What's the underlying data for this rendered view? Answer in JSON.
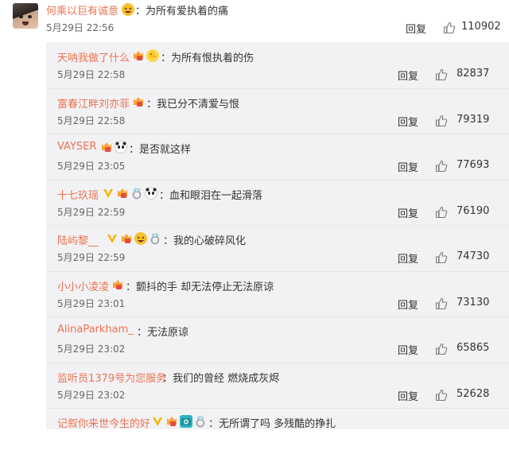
{
  "main_comment": {
    "user": "何乘以巨有诚意",
    "text": "：为所有爱执着的痛",
    "time": "5月29日 22:56",
    "reply_label": "回复",
    "likes": "110902"
  },
  "replies": [
    {
      "user": "天呐我做了什么",
      "text": "：为所有恨执着的伤",
      "time": "5月29日 22:58",
      "reply_label": "回复",
      "likes": "82837"
    },
    {
      "user": "富春江畔刘亦菲",
      "text": "：我已分不清爱与恨",
      "time": "5月29日 22:58",
      "reply_label": "回复",
      "likes": "79319"
    },
    {
      "user": "VAYSER",
      "text": "：是否就这样",
      "time": "5月29日 23:05",
      "reply_label": "回复",
      "likes": "77693"
    },
    {
      "user": "十七玖瑶",
      "text": "：血和眼泪在一起滑落",
      "time": "5月29日 22:59",
      "reply_label": "回复",
      "likes": "76190"
    },
    {
      "user": "陆屿黎__",
      "text": "：我的心破碎风化",
      "time": "5月29日 22:59",
      "reply_label": "回复",
      "likes": "74730"
    },
    {
      "user": "小小小凌凌",
      "text": "：颤抖的手 却无法停止无法原谅",
      "time": "5月29日 23:01",
      "reply_label": "回复",
      "likes": "73130"
    },
    {
      "user": "AlinaParkham_",
      "text": "：无法原谅",
      "time": "5月29日 23:02",
      "reply_label": "回复",
      "likes": "65865"
    },
    {
      "user": "监听员1379号为您服务",
      "text": "：我们的曾经 燃烧成灰烬",
      "time": "5月29日 23:02",
      "reply_label": "回复",
      "likes": "52628"
    },
    {
      "user": "记叙你来世今生的好",
      "text": "：无所谓了吗 多残酷的挣扎",
      "time": "",
      "reply_label": "",
      "likes": ""
    }
  ],
  "colors": {
    "username": "#eb7350",
    "panel_bg": "#f2f2f5",
    "vip_badge": "#f7a43a",
    "verified_v": "#f6b400"
  },
  "icons": [
    "thumbs-up-icon",
    "vip-badge-icon",
    "verified-v-icon",
    "laughing-emoji-icon",
    "duck-emoji-icon",
    "panda-emoji-icon",
    "diamond-ring-icon",
    "camera-emoji-icon"
  ]
}
